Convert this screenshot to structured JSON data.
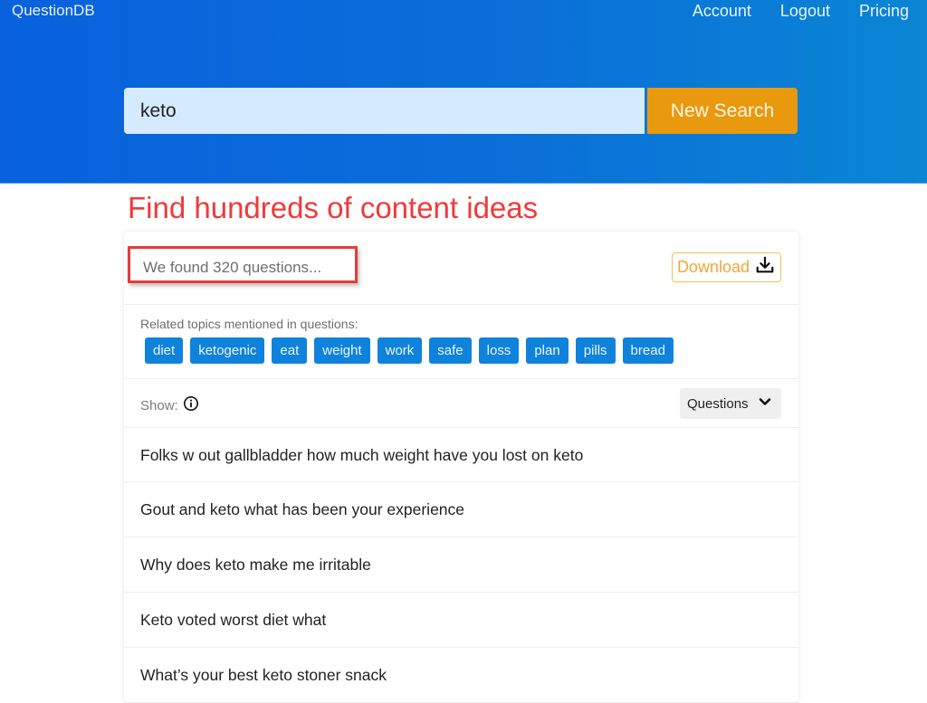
{
  "header": {
    "brand": "QuestionDB",
    "nav": [
      "Account",
      "Logout",
      "Pricing"
    ],
    "colors": {
      "gradient_start": "#0961de",
      "gradient_end": "#0a86d4"
    }
  },
  "search": {
    "value": "keto",
    "button_label": "New Search",
    "button_color": "#e8990d"
  },
  "tagline": "Find hundreds of content ideas",
  "results": {
    "found_text": "We found 320 questions...",
    "download_label": "Download",
    "download_icon": "download-icon",
    "topics_label": "Related topics mentioned in questions:",
    "topics": [
      "diet",
      "ketogenic",
      "eat",
      "weight",
      "work",
      "safe",
      "loss",
      "plan",
      "pills",
      "bread"
    ],
    "show_label": "Show:",
    "show_info_icon": "info-icon",
    "show_select_value": "Questions",
    "show_select_icon": "chevron-down-icon",
    "questions": [
      "Folks w out gallbladder how much weight have you lost on keto",
      "Gout and keto what has been your experience",
      "Why does keto make me irritable",
      "Keto voted worst diet what",
      "What’s your best keto stoner snack"
    ]
  }
}
